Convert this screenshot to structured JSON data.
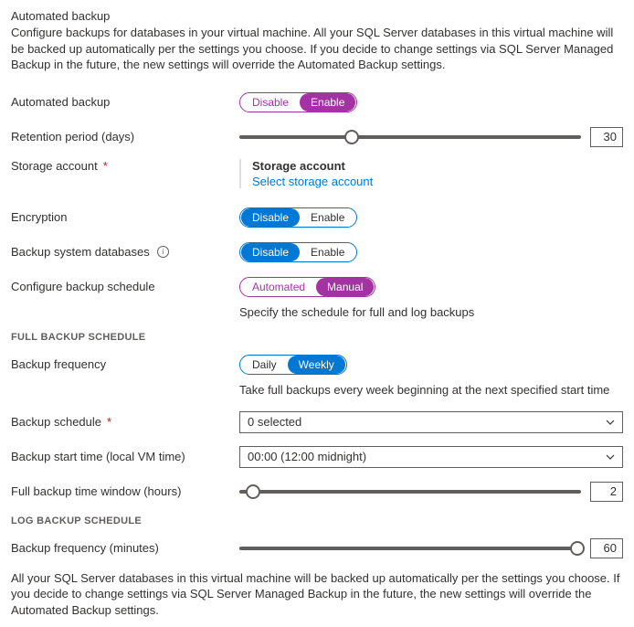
{
  "header": {
    "title": "Automated backup",
    "description": "Configure backups for databases in your virtual machine. All your SQL Server databases in this virtual machine will be backed up automatically per the settings you choose. If you decide to change settings via SQL Server Managed Backup in the future, the new settings will override the Automated Backup settings."
  },
  "fields": {
    "autobackup": {
      "label": "Automated backup",
      "opt_disable": "Disable",
      "opt_enable": "Enable"
    },
    "retention": {
      "label": "Retention period (days)",
      "value": "30"
    },
    "storage": {
      "label": "Storage account",
      "block_title": "Storage account",
      "link": "Select storage account"
    },
    "encryption": {
      "label": "Encryption",
      "opt_disable": "Disable",
      "opt_enable": "Enable"
    },
    "sysdb": {
      "label": "Backup system databases",
      "opt_disable": "Disable",
      "opt_enable": "Enable"
    },
    "schedule": {
      "label": "Configure backup schedule",
      "opt_auto": "Automated",
      "opt_manual": "Manual",
      "helper": "Specify the schedule for full and log backups"
    }
  },
  "full_section": {
    "heading": "FULL BACKUP SCHEDULE",
    "frequency": {
      "label": "Backup frequency",
      "opt_daily": "Daily",
      "opt_weekly": "Weekly",
      "helper": "Take full backups every week beginning at the next specified start time"
    },
    "schedule": {
      "label": "Backup schedule",
      "value": "0 selected"
    },
    "start": {
      "label": "Backup start time (local VM time)",
      "value": "00:00 (12:00 midnight)"
    },
    "window": {
      "label": "Full backup time window (hours)",
      "value": "2"
    }
  },
  "log_section": {
    "heading": "LOG BACKUP SCHEDULE",
    "frequency": {
      "label": "Backup frequency (minutes)",
      "value": "60"
    }
  },
  "footer": "All your SQL Server databases in this virtual machine will be backed up automatically per the settings you choose. If you decide to change settings via SQL Server Managed Backup in the future, the new settings will override the Automated Backup settings."
}
